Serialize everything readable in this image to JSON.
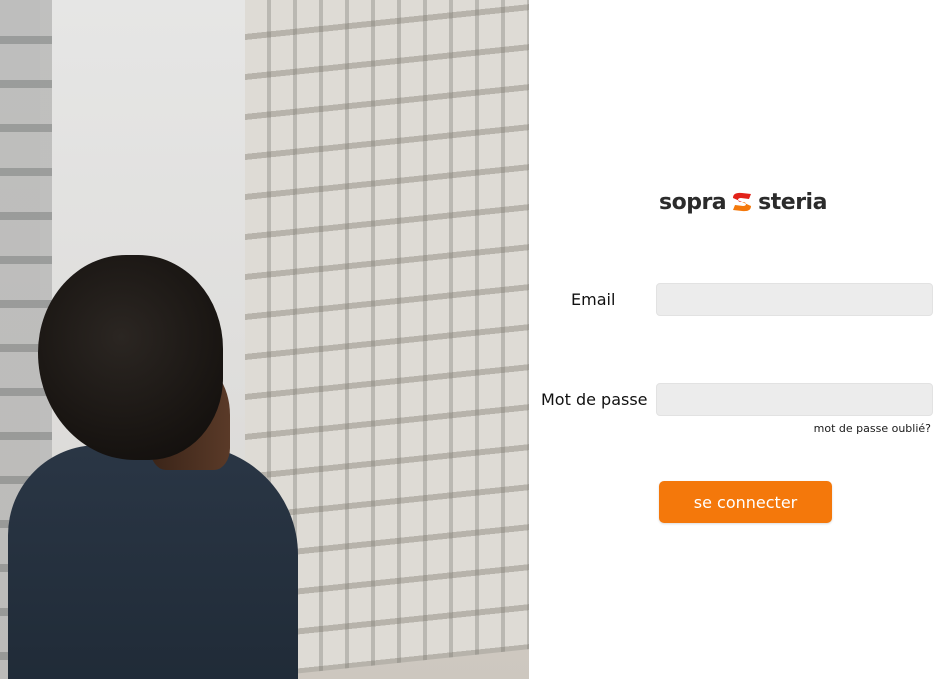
{
  "brand": {
    "logo_left": "sopra",
    "logo_right": "steria",
    "accent_color": "#f4780b",
    "logo_mark_colors": [
      "#e2231a",
      "#f4780b"
    ]
  },
  "login_form": {
    "email_label": "Email",
    "email_value": "",
    "password_label": "Mot de passe",
    "password_value": "",
    "forgot_password_link": "mot de passe oublié?",
    "submit_label": "se connecter"
  },
  "hero_image": {
    "icon": "photo-woman-looking-up-at-building"
  }
}
